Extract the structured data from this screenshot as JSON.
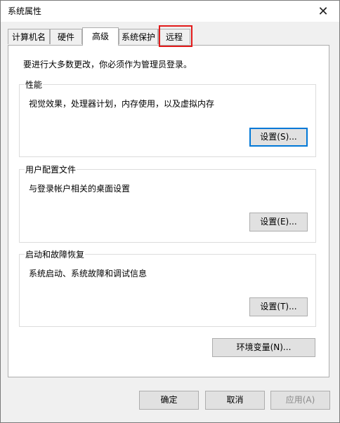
{
  "window": {
    "title": "系统属性",
    "close_glyph": "✕"
  },
  "tabs": [
    {
      "label": "计算机名",
      "active": false
    },
    {
      "label": "硬件",
      "active": false
    },
    {
      "label": "高级",
      "active": true
    },
    {
      "label": "系统保护",
      "active": false
    },
    {
      "label": "远程",
      "active": false,
      "highlighted": true
    }
  ],
  "advanced": {
    "admin_note": "要进行大多数更改，你必须作为管理员登录。",
    "performance": {
      "title": "性能",
      "description": "视觉效果，处理器计划，内存使用，以及虚拟内存",
      "button": "设置(S)..."
    },
    "user_profiles": {
      "title": "用户配置文件",
      "description": "与登录帐户相关的桌面设置",
      "button": "设置(E)..."
    },
    "startup_recovery": {
      "title": "启动和故障恢复",
      "description": "系统启动、系统故障和调试信息",
      "button": "设置(T)..."
    },
    "env_vars_button": "环境变量(N)..."
  },
  "footer": {
    "ok": "确定",
    "cancel": "取消",
    "apply": "应用(A)"
  },
  "colors": {
    "accent": "#0078d7",
    "highlight": "#e21a1a",
    "dialog_bg": "#f0f0f0"
  }
}
